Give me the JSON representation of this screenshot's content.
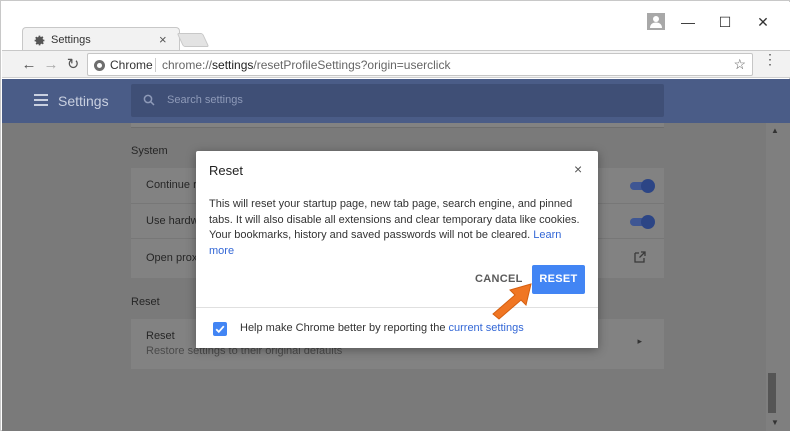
{
  "tab": {
    "title": "Settings",
    "close": "×"
  },
  "window": {
    "minimize": "—",
    "maximize": "☐",
    "close": "✕"
  },
  "toolbar": {
    "back": "←",
    "forward": "→",
    "reload": "↻",
    "site_label": "Chrome",
    "url_host": "chrome://",
    "url_path": "settings",
    "url_rest": "/resetProfileSettings?origin=userclick",
    "star": "☆",
    "menu": "⋮"
  },
  "header": {
    "title": "Settings",
    "search_placeholder": "Search settings"
  },
  "content": {
    "system_title": "System",
    "rows": [
      {
        "label": "Continue ru"
      },
      {
        "label": "Use hardwa"
      },
      {
        "label": "Open proxy"
      }
    ],
    "reset_title": "Reset",
    "reset_row": {
      "label": "Reset",
      "sub": "Restore settings to their original defaults"
    }
  },
  "dialog": {
    "title": "Reset",
    "close": "×",
    "body": "This will reset your startup page, new tab page, search engine, and pinned tabs. It will also disable all extensions and clear temporary data like cookies. Your bookmarks, history and saved passwords will not be cleared.",
    "learn_more": "Learn more",
    "cancel": "CANCEL",
    "reset": "RESET",
    "footer_text": "Help make Chrome better by reporting the",
    "footer_link": "current settings",
    "checkbox_checked": true
  },
  "colors": {
    "accent": "#4285f4",
    "header": "#4a5c87",
    "arrow": "#f07623"
  }
}
